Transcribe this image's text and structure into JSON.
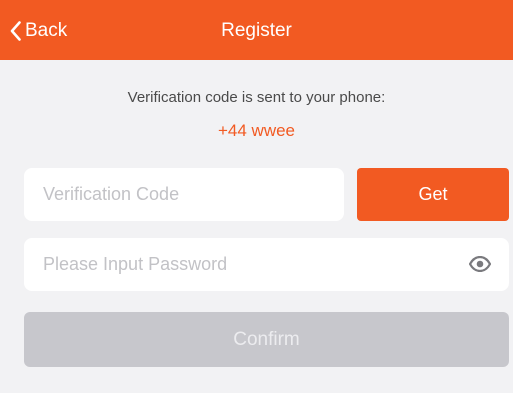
{
  "nav": {
    "back_label": "Back",
    "title": "Register",
    "bar_color": "#f25a22"
  },
  "info": {
    "message": "Verification code is sent to your phone:",
    "phone": "+44 wwee"
  },
  "form": {
    "code_placeholder": "Verification Code",
    "code_value": "",
    "get_label": "Get",
    "password_placeholder": "Please Input Password",
    "password_value": "",
    "eye_icon": "eye-icon",
    "confirm_label": "Confirm"
  },
  "colors": {
    "accent": "#f25a22",
    "background": "#f2f2f4",
    "disabled_button": "#c7c7cc"
  }
}
